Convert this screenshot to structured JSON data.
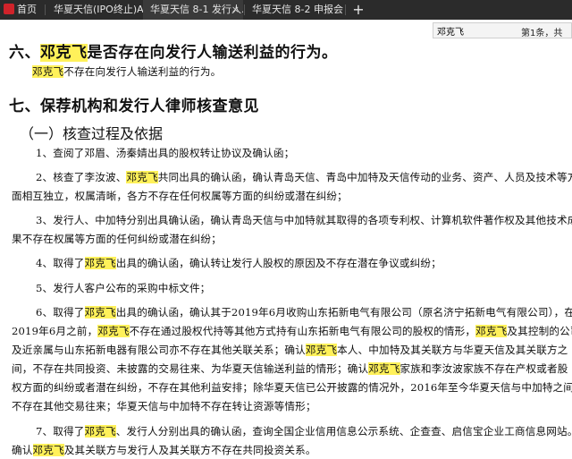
{
  "tabs": [
    {
      "label": "首页",
      "active": false
    },
    {
      "label": "华夏天信(IPO终止)A1...",
      "active": false
    },
    {
      "label": "华夏天信 8-1 发行人...",
      "active": true
    },
    {
      "label": "华夏天信 8-2 申报会...",
      "active": false
    }
  ],
  "tab_close": "×",
  "new_tab": "+",
  "find": {
    "query": "邓克飞",
    "result": "第1条，共"
  },
  "highlight": "邓克飞",
  "doc": {
    "s6": {
      "before": "六、",
      "after": "是否存在向发行人输送利益的行为。"
    },
    "s6_line": "不存在向发行人输送利益的行为。",
    "s7": "七、保荐机构和发行人律师核查意见",
    "sub1": "（一）核查过程及依据",
    "i1": "1、查阅了邓眉、汤秦婧出具的股权转让协议及确认函；",
    "i2a_pre": "2、核查了李汝波、",
    "i2a_post": "共同出具的确认函，确认青岛天信、青岛中加特及天信传动的业务、资产、人员及技术等方",
    "i2b": "面相互独立，权属清晰，各方不存在任何权属等方面的纠纷或潜在纠纷；",
    "i3a": "3、发行人、中加特分别出具确认函，确认青岛天信与中加特就其取得的各项专利权、计算机软件著作权及其他技术成",
    "i3b": "果不存在权属等方面的任何纠纷或潜在纠纷；",
    "i4_pre": "4、取得了",
    "i4_post": "出具的确认函，确认转让发行人股权的原因及不存在潜在争议或纠纷；",
    "i5": "5、发行人客户公布的采购中标文件；",
    "i6a_pre": "6、取得了",
    "i6a_post": "出具的确认函，确认其于2019年6月收购山东拓新电气有限公司（原名济宁拓新电气有限公司），在",
    "i6b_a": "2019年6月之前，",
    "i6b_b": "不存在通过股权代持等其他方式持有山东拓新电气有限公司的股权的情形，",
    "i6b_c": "及其控制的公司",
    "i6c_a": "及近亲属与山东拓新电器有限公司亦不存在其他关联关系；确认",
    "i6c_b": "本人、中加特及其关联方与华夏天信及其关联方之",
    "i6d_a": "间，不存在共同投资、未披露的交易往来、为华夏天信输送利益的情形；确认",
    "i6d_b": "家族和李汝波家族不存在产权或者股",
    "i6e": "权方面的纠纷或者潜在纠纷，不存在其他利益安排；除华夏天信已公开披露的情况外，2016年至今华夏天信与中加特之间",
    "i6f": "不存在其他交易往来；华夏天信与中加特不存在转让资源等情形；",
    "i7a_pre": "7、取得了",
    "i7a_post": "、发行人分别出具的确认函，查询全国企业信用信息公示系统、企查查、启信宝企业工商信息网站。",
    "i7b_pre": "确认",
    "i7b_post": "及其关联方与发行人及其关联方不存在共同投资关系。"
  }
}
